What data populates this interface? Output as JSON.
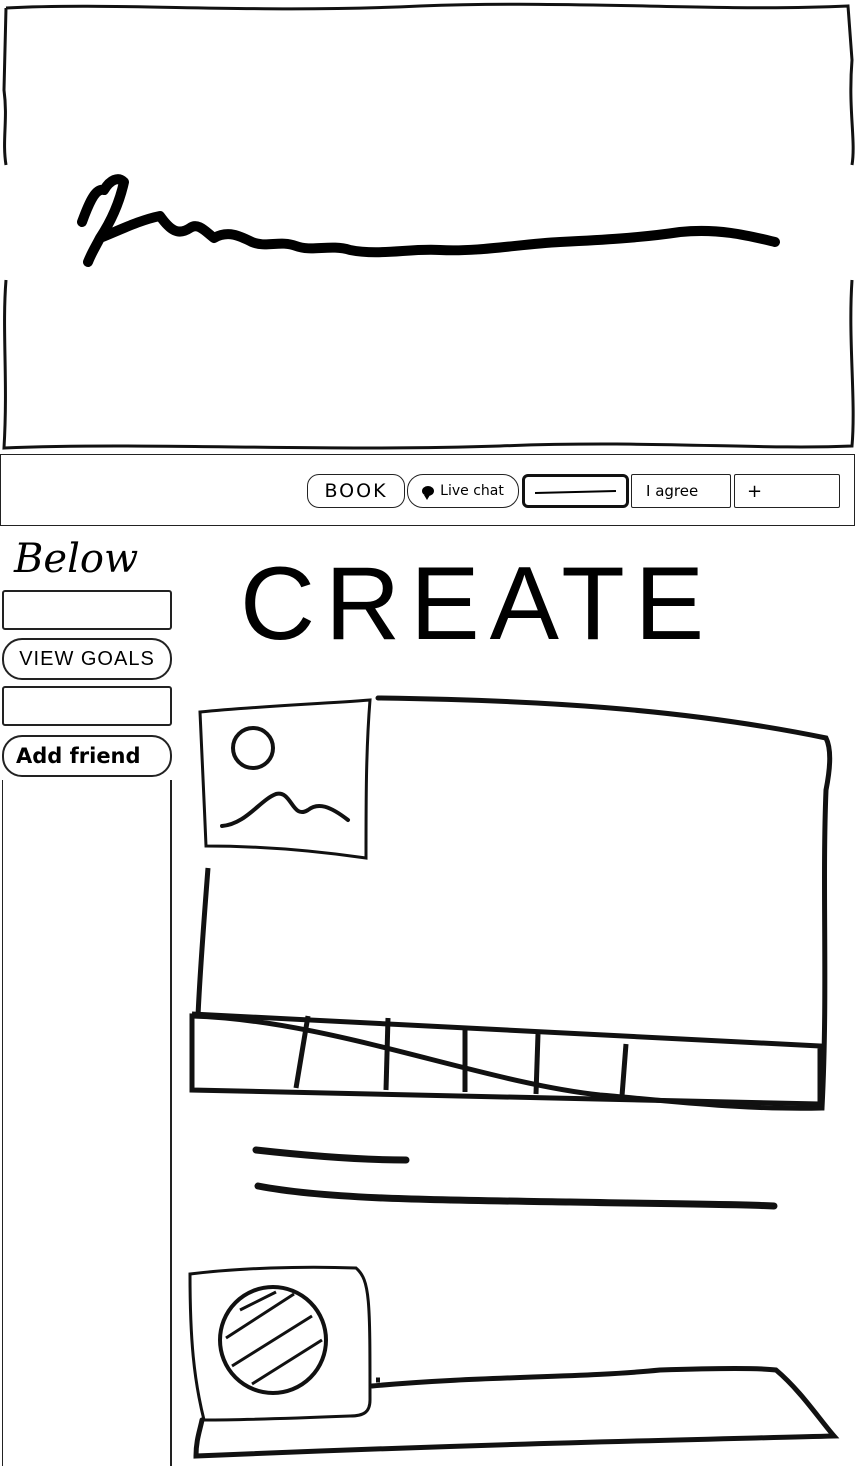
{
  "banner": {
    "signature_icon": "handwritten-signature"
  },
  "toolbar": {
    "book_label": "BOOK",
    "live_chat_label": "Live chat",
    "text_field_value": "",
    "agree_label": "I agree",
    "plus_label": "+"
  },
  "sidebar": {
    "title": "Below",
    "input_1_value": "",
    "view_goals_label": "VIEW GOALS",
    "input_2_value": "",
    "add_friend_label": "Add friend"
  },
  "main": {
    "heading": "CREATE",
    "card": {
      "image_icon": "image-placeholder-icon",
      "tab_count": 6
    },
    "text_lines_icon": "text-placeholder",
    "profile": {
      "avatar_icon": "avatar-placeholder-icon"
    }
  }
}
